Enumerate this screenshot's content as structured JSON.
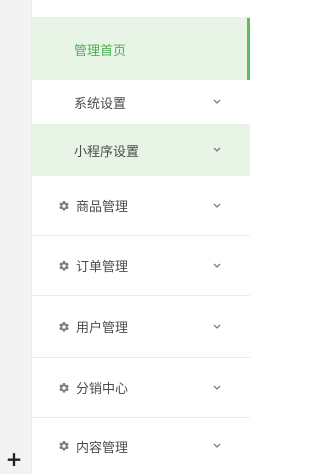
{
  "toolbar": {
    "add_icon": "plus-icon"
  },
  "menu": {
    "active_item": "管理首页",
    "colors": {
      "active_text": "#4caf50",
      "active_bg": "#e8f5e6",
      "text": "#4b4b4b",
      "icon": "#7c7c7c"
    },
    "items": [
      {
        "label": "管理首页",
        "type": "sub",
        "active": true,
        "has_chevron": false
      },
      {
        "label": "系统设置",
        "type": "sub",
        "active": false,
        "has_chevron": true,
        "icon": "chevron-down-icon"
      },
      {
        "label": "小程序设置",
        "type": "sub",
        "active": false,
        "has_chevron": true,
        "icon": "chevron-down-icon"
      },
      {
        "label": "商品管理",
        "type": "group",
        "icon": "gear-icon",
        "has_chevron": true
      },
      {
        "label": "订单管理",
        "type": "group",
        "icon": "gear-icon",
        "has_chevron": true
      },
      {
        "label": "用户管理",
        "type": "group",
        "icon": "gear-icon",
        "has_chevron": true
      },
      {
        "label": "分销中心",
        "type": "group",
        "icon": "gear-icon",
        "has_chevron": true
      },
      {
        "label": "内容管理",
        "type": "group",
        "icon": "gear-icon",
        "has_chevron": true
      }
    ]
  }
}
